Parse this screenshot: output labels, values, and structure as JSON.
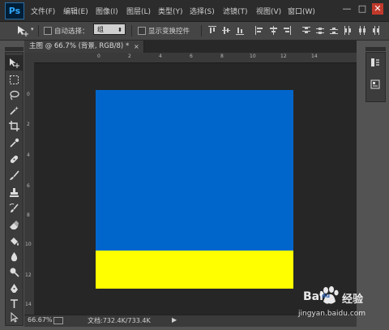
{
  "app": {
    "logo": "Ps"
  },
  "menu": [
    "文件(F)",
    "编辑(E)",
    "图像(I)",
    "图层(L)",
    "类型(Y)",
    "选择(S)",
    "滤镜(T)",
    "视图(V)",
    "窗口(W)"
  ],
  "window_controls": {
    "minimize": "—",
    "maximize": "□",
    "close": "✕"
  },
  "options": {
    "auto_select_label": "自动选择：",
    "auto_select_value": "组",
    "show_transform_label": "显示变换控件"
  },
  "document": {
    "tab_title": "主图 @ 66.7% (背景, RGB/8) *",
    "tab_close": "×",
    "ruler_h": [
      "0",
      "2",
      "4",
      "6",
      "8",
      "10",
      "12",
      "14"
    ],
    "ruler_v": [
      "0",
      "2",
      "4",
      "6",
      "8",
      "10",
      "12",
      "14"
    ],
    "canvas_colors": {
      "top": "#0066cc",
      "bottom": "#ffff00"
    },
    "canvas_split_fraction": 0.81
  },
  "status": {
    "zoom": "66.67%",
    "doc_size": "文档:732.4K/733.4K",
    "arrow": "▶"
  },
  "tools": [
    "move-tool",
    "marquee-tool",
    "lasso-tool",
    "magic-wand-tool",
    "crop-tool",
    "eyedropper-tool",
    "healing-brush-tool",
    "brush-tool",
    "clone-stamp-tool",
    "history-brush-tool",
    "eraser-tool",
    "paint-bucket-tool",
    "blur-tool",
    "dodge-tool",
    "pen-tool",
    "type-tool",
    "path-selection-tool"
  ],
  "watermark": {
    "brand": "Bai",
    "paw": "du",
    "site_name": "经验",
    "url": "jingyan.baidu.com"
  }
}
